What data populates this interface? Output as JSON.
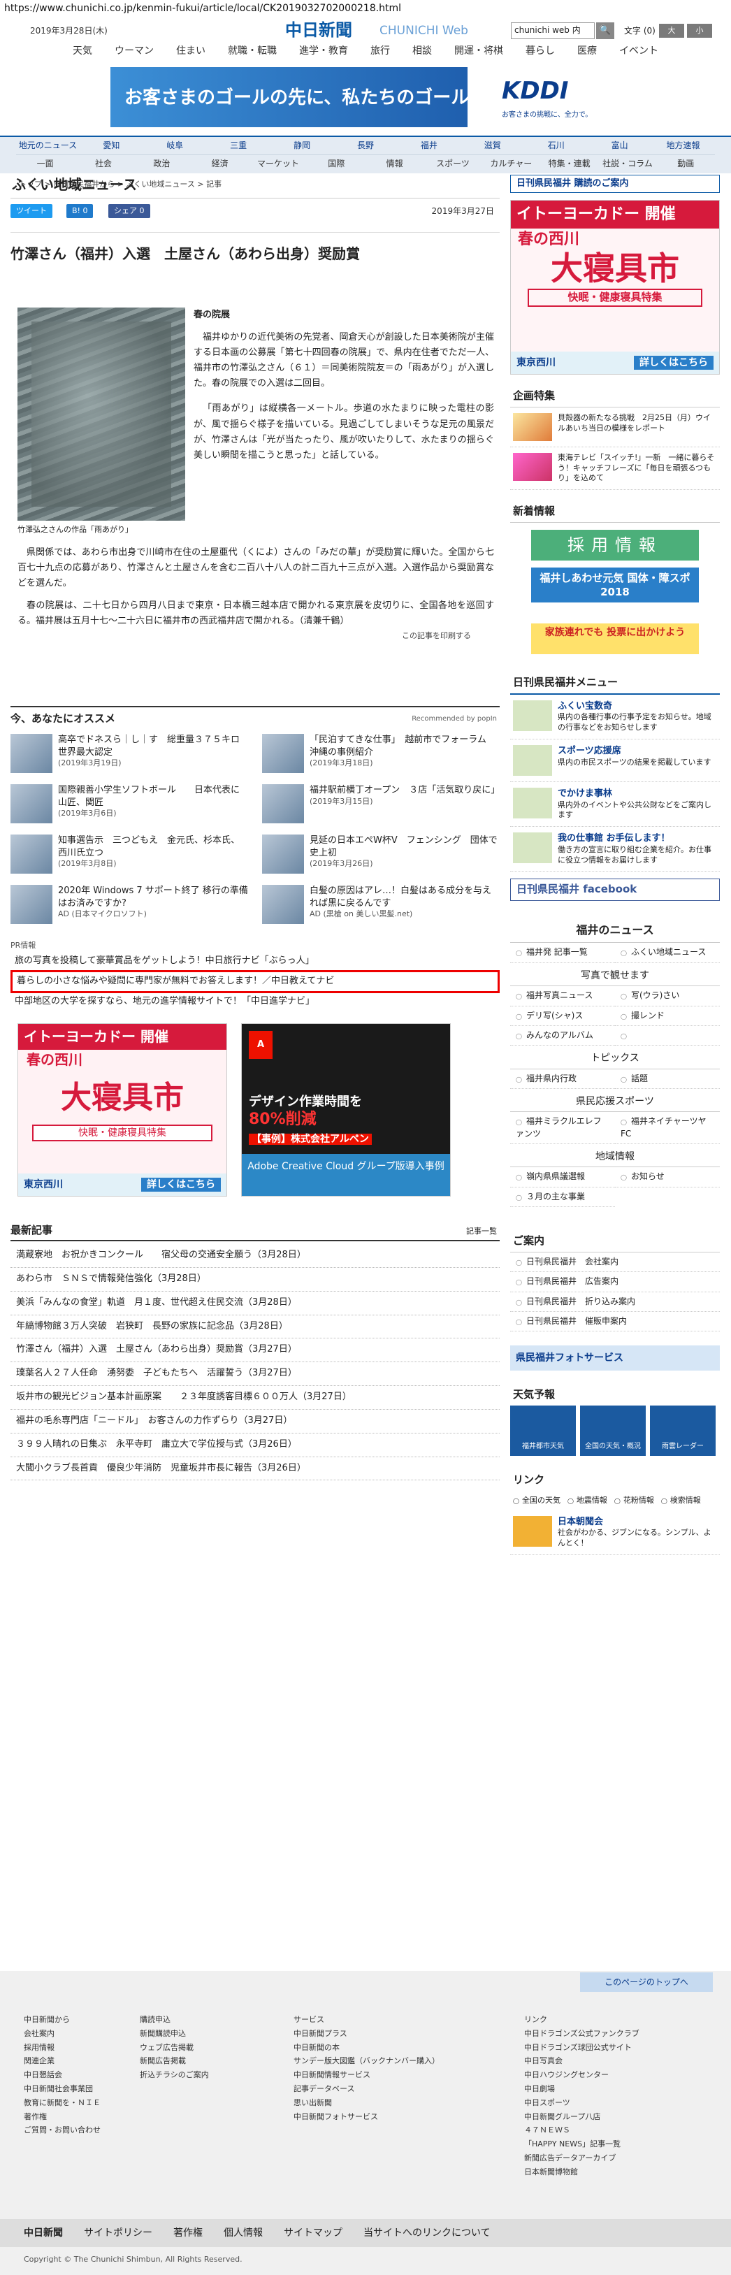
{
  "url": "https://www.chunichi.co.jp/kenmin-fukui/article/local/CK2019032702000218.html",
  "header": {
    "date": "2019年3月28日(木)",
    "logo": "中日新聞",
    "logo_en": "CHUNICHI Web",
    "search_placeholder": "chunichi web 内",
    "search_btn": "🔍",
    "moji": "文字 (0)",
    "mbtn1": "大",
    "mbtn2": "小"
  },
  "topnav": [
    "天気",
    "ウーマン",
    "住まい",
    "就職・転職",
    "進学・教育",
    "旅行",
    "相談",
    "開運・将棋",
    "暮らし",
    "医療",
    "イベント"
  ],
  "banner": {
    "text": "お客さまのゴールの先に、私たちのゴールはある。",
    "brand": "KDDI",
    "brand_sub": "お客さまの挑戦に、全力で。"
  },
  "gnav1": [
    "地元のニュース",
    "愛知",
    "岐阜",
    "三重",
    "静岡",
    "長野",
    "福井",
    "滋賀",
    "石川",
    "富山",
    "地方速報"
  ],
  "gnav2": [
    "一面",
    "社会",
    "政治",
    "経済",
    "マーケット",
    "国際",
    "情報",
    "スポーツ",
    "カルチャー",
    "特集・連載",
    "社説・コラム",
    "動画"
  ],
  "crumb": "トップ > 日刊県民福井から > ふくい地域ニュース > 記事",
  "section_title": "ふくい地域ニュース",
  "share": {
    "tw": "ツイート",
    "b": "B! 0",
    "fb": "シェア 0",
    "date": "2019年3月27日"
  },
  "article": {
    "title": "竹澤さん（福井）入選　土屋さん（あわら出身）奨励賞",
    "caption": "竹澤弘之さんの作品「雨あがり」",
    "subhead": "春の院展",
    "p1": "福井ゆかりの近代美術の先覚者、岡倉天心が創設した日本美術院が主催する日本画の公募展「第七十四回春の院展」で、県内在住者でただ一人、福井市の竹澤弘之さん（６１）＝同美術院院友＝の「雨あがり」が入選した。春の院展での入選は二回目。",
    "p2": "「雨あがり」は縦横各一メートル。歩道の水たまりに映った電柱の影が、風で揺らぐ様子を描いている。見過ごしてしまいそうな足元の風景だが、竹澤さんは「光が当たったり、風が吹いたりして、水たまりの揺らぐ美しい瞬間を描こうと思った」と話している。",
    "p3": "県関係では、あわら市出身で川崎市在住の土屋亜代（くによ）さんの「みだの華」が奨励賞に輝いた。全国から七百七十九点の応募があり、竹澤さんと土屋さんを含む二百八十八人の計二百九十三点が入選。入選作品から奨励賞などを選んだ。",
    "p4": "春の院展は、二十七日から四月八日まで東京・日本橋三越本店で開かれる東京展を皮切りに、全国各地を巡回する。福井展は五月十七〜二十六日に福井市の西武福井店で開かれる。（清兼千鶴）",
    "print": "この記事を印刷する"
  },
  "rec": {
    "title": "今、あなたにオススメ",
    "powered": "Recommended by popIn",
    "items": [
      {
        "t": "高卒でドネスら｜し｜す　総重量３７５キロ　世界最大認定",
        "d": "(2019年3月19日)"
      },
      {
        "t": "「民泊すてきな仕事」　越前市でフォーラム　沖縄の事例紹介",
        "d": "(2019年3月18日)"
      },
      {
        "t": "国際親善小学生ソフトボール　　日本代表に山匠、関匠",
        "d": "(2019年3月6日)"
      },
      {
        "t": "福井駅前横丁オープン　３店「活気取り戻に」",
        "d": "(2019年3月15日)"
      },
      {
        "t": "知事選告示　三つどもえ　金元氏、杉本氏、西川氏立つ",
        "d": "(2019年3月8日)"
      },
      {
        "t": "見延の日本エペW杯V　フェンシング　団体で史上初",
        "d": "(2019年3月26日)"
      },
      {
        "t": "2020年 Windows 7 サポート終了 移行の準備はお済みですか?",
        "d": "AD (日本マイクロソフト)"
      },
      {
        "t": "白髪の原因はアレ…！白髪はある成分を与えれば黒に戻るんです",
        "d": "AD (黒槍 on 美しい黒髪.net)"
      }
    ]
  },
  "pr": {
    "label": "PR情報",
    "i1": "旅の写真を投稿して豪華賞品をゲットしよう！中日旅行ナビ「ぶらっ人」",
    "i2": "暮らしの小さな悩みや疑問に専門家が無料でお答えします！／中日教えてナビ",
    "i3": "中部地区の大学を探すなら、地元の進学情報サイトで！「中日進学ナビ」"
  },
  "ad_ito": {
    "top": "イトーヨーカドー 開催",
    "season": "春の西川",
    "big": "大寝具市",
    "sub": "快眠・健康寝具特集",
    "place": "東京西川",
    "btn": "詳しくはこちら"
  },
  "ad_adobe": {
    "cap1": "デザイン作業時間を",
    "cap2": "80%削減",
    "cap3": "【事例】株式会社アルペン",
    "bot": "Adobe Creative Cloud グループ版導入事例"
  },
  "latest": {
    "title": "最新記事",
    "more": "記事一覧",
    "items": [
      "満蔵寮地　お祝かきコンクール　　宿父母の交通安全願う（3月28日）",
      "あわら市　ＳＮＳで情報発信強化（3月28日）",
      "美浜「みんなの食堂」軌道　月１度、世代超え住民交流（3月28日）",
      "年縞博物館３万人突破　岩狭町　長野の家族に記念品（3月28日）",
      "竹澤さん（福井）入選　土屋さん（あわら出身）奨励賞（3月27日）",
      "璞葉名人２７人任命　湧努委　子どもたちへ　活躍誓う（3月27日）",
      "坂井市の観光ビジョン基本計画原案　　２３年度誘客目標６００万人（3月27日）",
      "福井の毛糸専門店「ニードル」　お客さんの力作ずらり（3月27日）",
      "３９９人晴れの日集ぶ　永平寺町　庸立大で学位授与式（3月26日）",
      "大聞小クラブ長首貢　優良少年消防　児童坂井市長に報告（3月26日）"
    ]
  },
  "side": {
    "kikaku_title": "企画特集",
    "k1": "貝殻器の新たなる挑戦　2月25日（月）ウイルあいち当日の模様をレポート",
    "k2": "東海テレビ「スイッチ!」一新　一緒に暮らそう！キャッチフレーズに「毎日を頑張るつもり」を込めて",
    "shinchaku": "新着情報",
    "saiyo": "採用情報",
    "kokutai": "福井しあわせ元気 国体・障スポ 2018",
    "kazoku": "家族連れでも 投票に出かけよう",
    "menu_title": "日刊県民福井メニュー",
    "m1t": "ふくい宝数奇",
    "m1": "県内の各種行事の行事予定をお知らせ。地域の行事などをお知らせします",
    "m2t": "スポーツ応援席",
    "m2": "県内の市民スポーツの結果を掲載しています",
    "m3t": "でかけま事林",
    "m3": "県内外のイベントや公共公財などをご案内します",
    "m4t": "我の仕事館 お手伝します！",
    "m4": "働き方の宣言に取り組む企業を紹介。お仕事に役立つ情報をお届けします",
    "fb": "日刊県民福井 facebook",
    "news_title": "福井のニュース",
    "n1": "福井発 記事一覧",
    "n2": "ふくい地域ニュース",
    "photo_title": "写真で観せます",
    "n3": "福井写真ニュース",
    "n4": "写(ウラ)さい",
    "n5": "デリ写(シャ)ス",
    "n6": "撮レンド",
    "n7": "みんなのアルバム",
    "topics": "トピックス",
    "n8": "福井県内行政",
    "n9": "話題",
    "sports": "県民応援スポーツ",
    "n10": "福井ミラクルエレファンツ",
    "n11": "福井ネイチャーツヤFC",
    "chiiki": "地域情報",
    "n12": "嶺内県県議選報",
    "n13": "お知らせ",
    "n14": "３月の主な事業",
    "annai": "ご案内",
    "a1": "日刊県民福井　会社案内",
    "a2": "日刊県民福井　広告案内",
    "a3": "日刊県民福井　折り込み案内",
    "a4": "日刊県民福井　催販申案内",
    "photosvc": "県民福井フォトサービス",
    "tenki": "天気予報",
    "t1": "福井都市天気",
    "t2": "全国の天気・概況",
    "t3": "雨雲レーダー",
    "link": "リンク",
    "l1": "全国の天気",
    "l2": "地震情報",
    "l3": "花粉情報",
    "l4": "検索情報",
    "nittoku": "日本朝聞会",
    "nittoku_d": "社会がわかる、ジブンになる。シンプル、よんとく！"
  },
  "footer": {
    "pagetop": "このページのトップへ",
    "c1": [
      "中日新聞から",
      "会社案内",
      "採用情報",
      "関連企業",
      "中日懇話会",
      "中日新聞社会事業団",
      "教育に新聞を・ＮＩＥ",
      "著作権",
      "ご質問・お問い合わせ"
    ],
    "c2": [
      "購読申込",
      "新聞購読申込",
      "ウェブ広告掲載",
      "新聞広告掲載",
      "折込チラシのご案内"
    ],
    "c3": [
      "サービス",
      "中日新聞プラス",
      "中日新聞の本",
      "サンデー版大図鑑（バックナンバー購入）",
      "中日新聞情報サービス",
      "記事データベース",
      "思い出新聞",
      "中日新聞フォトサービス"
    ],
    "c4": [
      "リンク",
      "中日ドラゴンズ公式ファンクラブ",
      "中日ドラゴンズ球団公式サイト",
      "中日写真会",
      "中日ハウジングセンター",
      "中日劇場",
      "中日スポーツ",
      "中日新聞グループ八店",
      "４７ＮＥＷＳ",
      "「HAPPY NEWS」記事一覧",
      "新聞広告データアーカイブ",
      "日本新聞博物館"
    ],
    "bar": [
      "中日新聞",
      "サイトポリシー",
      "著作権",
      "個人情報",
      "サイトマップ",
      "当サイトへのリンクについて"
    ],
    "copy": "Copyright © The Chunichi Shimbun, All Rights Reserved."
  }
}
